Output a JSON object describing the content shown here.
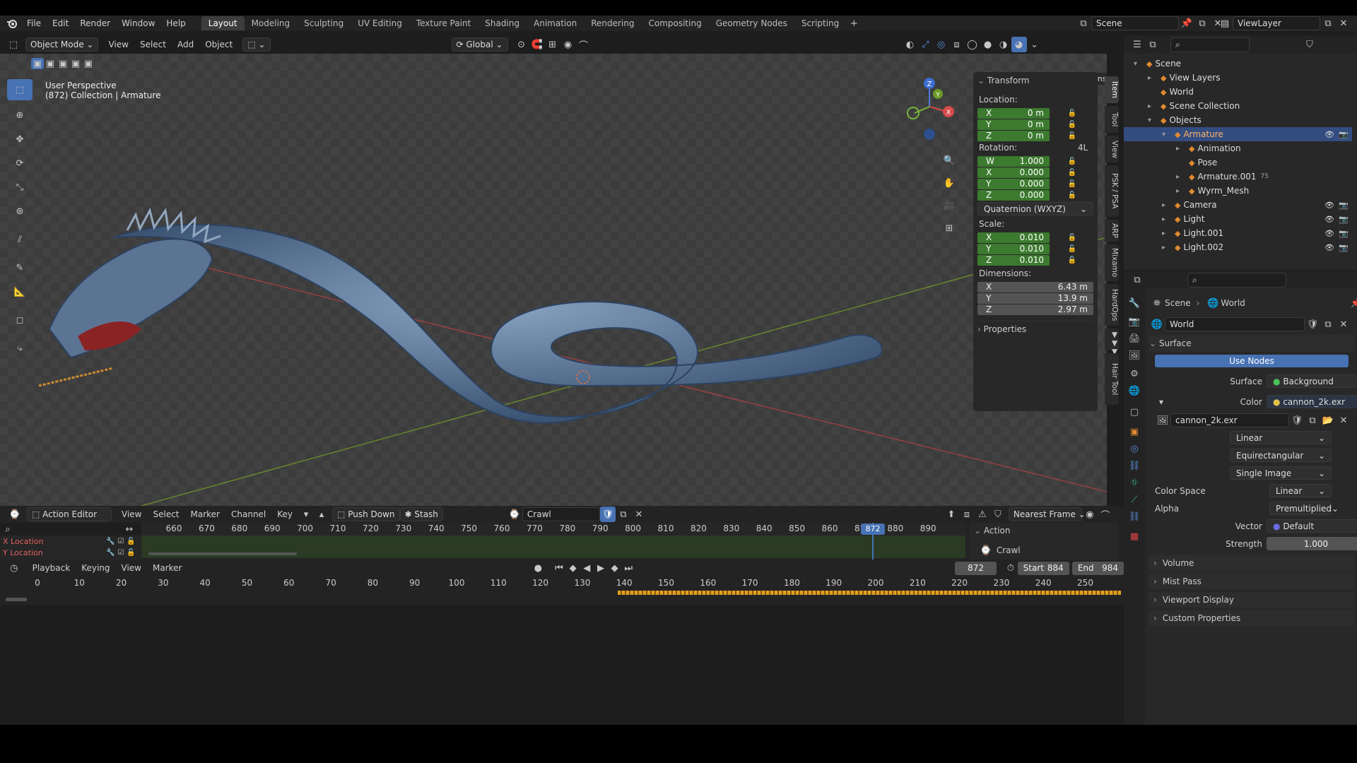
{
  "topbar": {
    "menus": [
      "File",
      "Edit",
      "Render",
      "Window",
      "Help"
    ],
    "workspaces": [
      "Layout",
      "Modeling",
      "Sculpting",
      "UV Editing",
      "Texture Paint",
      "Shading",
      "Animation",
      "Rendering",
      "Compositing",
      "Geometry Nodes",
      "Scripting"
    ],
    "add_workspace": "+",
    "scene": "Scene",
    "view_layer": "ViewLayer"
  },
  "viewport": {
    "mode": "Object Mode",
    "menus": [
      "View",
      "Select",
      "Add",
      "Object"
    ],
    "orientation": "Global",
    "options": "Options",
    "info_line1": "User Perspective",
    "info_line2": "(872) Collection | Armature",
    "gizmo": {
      "z": "Z",
      "y": "Y",
      "x": "X"
    }
  },
  "n_panel": {
    "tabs": [
      "Item",
      "Tool",
      "View",
      "PSK / PSA",
      "ARP",
      "Mixamo",
      "HardOps",
      "▼▼▼",
      "Hair Tool"
    ],
    "transform_header": "Transform",
    "location_label": "Location:",
    "location": [
      {
        "axis": "X",
        "value": "0 m"
      },
      {
        "axis": "Y",
        "value": "0 m"
      },
      {
        "axis": "Z",
        "value": "0 m"
      }
    ],
    "rotation_label": "Rotation:",
    "rotation_mode_short": "4L",
    "rotation": [
      {
        "axis": "W",
        "value": "1.000"
      },
      {
        "axis": "X",
        "value": "0.000"
      },
      {
        "axis": "Y",
        "value": "0.000"
      },
      {
        "axis": "Z",
        "value": "0.000"
      }
    ],
    "rotation_mode": "Quaternion (WXYZ)",
    "scale_label": "Scale:",
    "scale": [
      {
        "axis": "X",
        "value": "0.010"
      },
      {
        "axis": "Y",
        "value": "0.010"
      },
      {
        "axis": "Z",
        "value": "0.010"
      }
    ],
    "dimensions_label": "Dimensions:",
    "dimensions": [
      {
        "axis": "X",
        "value": "6.43 m"
      },
      {
        "axis": "Y",
        "value": "13.9 m"
      },
      {
        "axis": "Z",
        "value": "2.97 m"
      }
    ],
    "properties_header": "Properties"
  },
  "outliner": {
    "items": [
      {
        "label": "Scene",
        "indent": 0,
        "exp": "▾"
      },
      {
        "label": "View Layers",
        "indent": 1,
        "exp": "▸"
      },
      {
        "label": "World",
        "indent": 1,
        "exp": ""
      },
      {
        "label": "Scene Collection",
        "indent": 1,
        "exp": "▸"
      },
      {
        "label": "Objects",
        "indent": 1,
        "exp": "▾"
      },
      {
        "label": "Armature",
        "indent": 2,
        "exp": "▾",
        "selected": true
      },
      {
        "label": "Animation",
        "indent": 3,
        "exp": "▸"
      },
      {
        "label": "Pose",
        "indent": 3,
        "exp": ""
      },
      {
        "label": "Armature.001",
        "indent": 3,
        "exp": "▸",
        "badge": "75"
      },
      {
        "label": "Wyrm_Mesh",
        "indent": 3,
        "exp": "▸"
      },
      {
        "label": "Camera",
        "indent": 2,
        "exp": "▸"
      },
      {
        "label": "Light",
        "indent": 2,
        "exp": "▸"
      },
      {
        "label": "Light.001",
        "indent": 2,
        "exp": "▸"
      },
      {
        "label": "Light.002",
        "indent": 2,
        "exp": "▸"
      }
    ]
  },
  "properties": {
    "breadcrumb": [
      "Scene",
      "World"
    ],
    "world_name": "World",
    "surface_header": "Surface",
    "use_nodes": "Use Nodes",
    "surface_label": "Surface",
    "surface_value": "Background",
    "color_label": "Color",
    "color_value": "cannon_2k.exr",
    "image_name": "cannon_2k.exr",
    "interp": "Linear",
    "projection": "Equirectangular",
    "source": "Single Image",
    "color_space_label": "Color Space",
    "color_space": "Linear",
    "alpha_label": "Alpha",
    "alpha": "Premultiplied",
    "vector_label": "Vector",
    "vector": "Default",
    "strength_label": "Strength",
    "strength": "1.000",
    "panels": [
      "Volume",
      "Mist Pass",
      "Viewport Display",
      "Custom Properties"
    ]
  },
  "action_editor": {
    "mode": "Action Editor",
    "menus": [
      "View",
      "Select",
      "Marker",
      "Channel",
      "Key"
    ],
    "push_down": "Push Down",
    "stash": "Stash",
    "action": "Crawl",
    "snap": "Nearest Frame",
    "ticks": [
      "660",
      "670",
      "680",
      "690",
      "700",
      "710",
      "720",
      "730",
      "740",
      "750",
      "760",
      "770",
      "780",
      "790",
      "800",
      "810",
      "820",
      "830",
      "840",
      "850",
      "860",
      "870",
      "880",
      "890"
    ],
    "current_frame": "872",
    "channels": [
      "X Location",
      "Y Location"
    ],
    "side_header": "Action",
    "side_action": "Crawl"
  },
  "timeline": {
    "menus": [
      "Playback",
      "Keying",
      "View",
      "Marker"
    ],
    "frame": "872",
    "start_label": "Start",
    "start": "884",
    "end_label": "End",
    "end": "984",
    "ticks": [
      "0",
      "10",
      "20",
      "30",
      "40",
      "50",
      "60",
      "70",
      "80",
      "90",
      "100",
      "110",
      "120",
      "130",
      "140",
      "150",
      "160",
      "170",
      "180",
      "190",
      "200",
      "210",
      "220",
      "230",
      "240",
      "250"
    ]
  }
}
